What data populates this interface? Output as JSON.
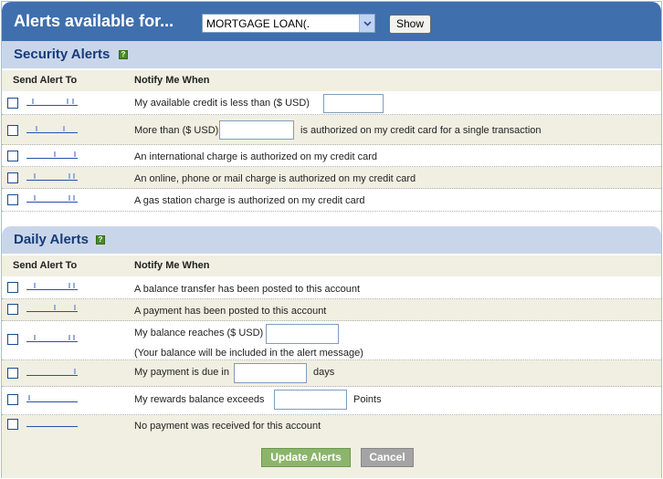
{
  "header": {
    "title": "Alerts available for...",
    "account_select_value": "MORTGAGE LOAN(.",
    "show_label": "Show"
  },
  "security": {
    "title": "Security Alerts",
    "help": "?",
    "col_send": "Send Alert To",
    "col_notify": "Notify Me When",
    "rows": [
      {
        "text": "My available credit is less than ($ USD)"
      },
      {
        "text_before": "More than ($ USD)",
        "text_after": "is authorized on my credit card for a single transaction"
      },
      {
        "text": "An international charge is authorized on my credit card"
      },
      {
        "text": "An online, phone or mail charge is authorized on my credit card"
      },
      {
        "text": "A gas station charge is authorized on my credit card"
      }
    ]
  },
  "daily": {
    "title": "Daily Alerts",
    "help": "?",
    "col_send": "Send Alert To",
    "col_notify": "Notify Me When",
    "rows": [
      {
        "text": "A balance transfer has been posted to this account"
      },
      {
        "text": "A payment has been posted to this account"
      },
      {
        "text": "My balance reaches ($ USD)",
        "note": "(Your balance will be included in the alert message)"
      },
      {
        "text": "My payment is due in",
        "text_after": "days"
      },
      {
        "text": "My rewards balance exceeds",
        "text_after": "Points"
      },
      {
        "text": "No payment was received for this account"
      }
    ]
  },
  "footer": {
    "update_label": "Update Alerts",
    "cancel_label": "Cancel"
  },
  "colors": {
    "topbar": "#3f6fad",
    "section_header": "#c9d6ea",
    "alt_row": "#f1efe2",
    "update_button": "#8cb56c",
    "cancel_button": "#a4a4a4"
  }
}
